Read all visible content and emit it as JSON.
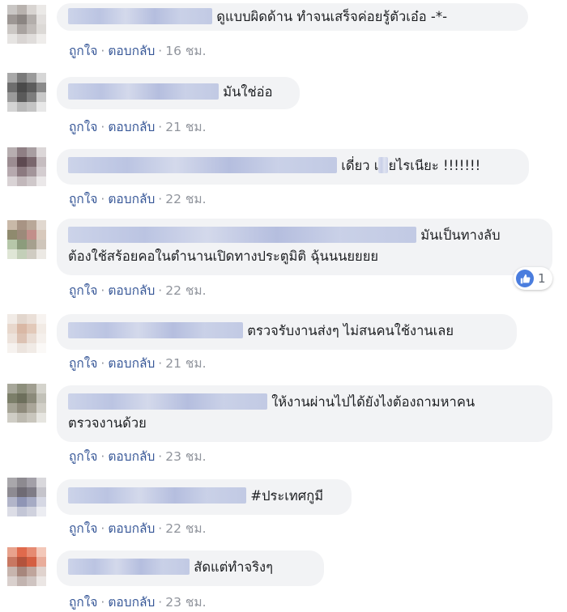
{
  "comments": [
    {
      "text": "ดูแบบผิดด้าน ทำจนเสร็จค่อยรู้ตัวเอ๋อ -*-",
      "actions": {
        "like": "ถูกใจ",
        "reply": "ตอบกลับ",
        "time": "16 ชม."
      }
    },
    {
      "text": "มันใช่อ่อ",
      "actions": {
        "like": "ถูกใจ",
        "reply": "ตอบกลับ",
        "time": "21 ชม."
      }
    },
    {
      "text_before": "เดี่ยว เ",
      "text_after": "ยไรเนียะ !!!!!!!",
      "actions": {
        "like": "ถูกใจ",
        "reply": "ตอบกลับ",
        "time": "22 ชม."
      }
    },
    {
      "line1": "มันเป็นทางลับ",
      "line2": "ต้องใช้สร้อยคอในตำนานเปิดทางประตูมิติ ฉุ้นนนยยยย",
      "reaction_count": "1",
      "actions": {
        "like": "ถูกใจ",
        "reply": "ตอบกลับ",
        "time": "22 ชม."
      }
    },
    {
      "text": "ตรวจรับงานส่งๆ ไม่สนคนใช้งานเลย",
      "actions": {
        "like": "ถูกใจ",
        "reply": "ตอบกลับ",
        "time": "21 ชม."
      }
    },
    {
      "line1": "ให้งานผ่านไปได้ยังไงต้องถามหาคน",
      "line2": "ตรวจงานด้วย",
      "actions": {
        "like": "ถูกใจ",
        "reply": "ตอบกลับ",
        "time": "23 ชม."
      }
    },
    {
      "text": "#ประเทศกูมี",
      "actions": {
        "like": "ถูกใจ",
        "reply": "ตอบกลับ",
        "time": "22 ชม."
      }
    },
    {
      "text": "สัดแต่ทำจริงๆ",
      "actions": {
        "like": "ถูกใจ",
        "reply": "ตอบกลับ",
        "time": "23 ชม."
      }
    }
  ],
  "colors": {
    "bubble": "#f2f3f5",
    "link": "#385898",
    "meta": "#90949c",
    "like_blue": "#4a7dde"
  },
  "icons": {
    "reaction": "like-thumb-icon"
  }
}
